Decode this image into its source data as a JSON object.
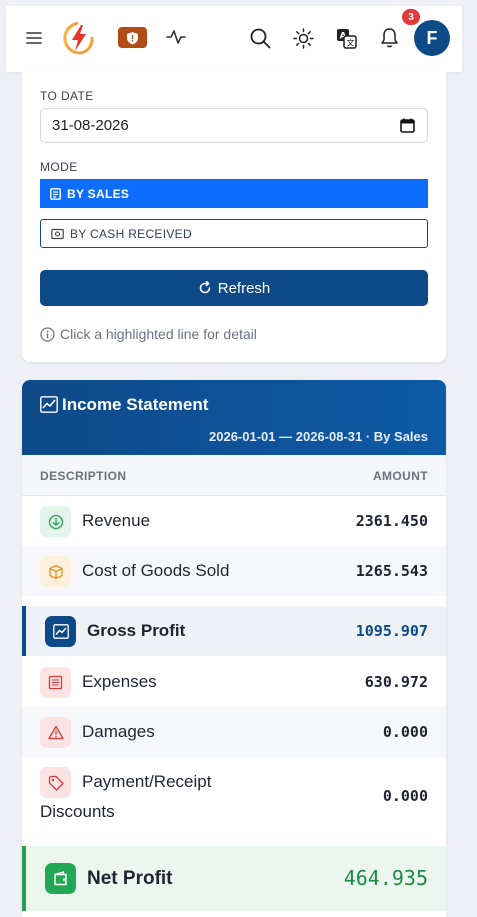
{
  "topbar": {
    "icons": [
      "hamburger-menu-icon",
      "app-logo",
      "shield-icon",
      "activity-pulse-icon",
      "search-icon",
      "theme-sun-icon",
      "translate-icon",
      "bell-icon"
    ],
    "notification_count": "3",
    "avatar_initial": "F"
  },
  "filters": {
    "to_date_label": "TO DATE",
    "to_date_value": "31-08-2026",
    "mode_label": "MODE",
    "mode_by_sales": "BY SALES",
    "mode_by_cash": "BY CASH RECEIVED",
    "refresh_label": "Refresh",
    "hint": "Click a highlighted line for detail"
  },
  "income": {
    "title": "Income Statement",
    "range": "2026-01-01 — 2026-08-31 · By Sales",
    "col_description": "DESCRIPTION",
    "col_amount": "AMOUNT",
    "rows": [
      {
        "label": "Revenue",
        "amount": "2361.450",
        "icon": "arrow-down-circle-icon"
      },
      {
        "label": "Cost of Goods Sold",
        "amount": "1265.543",
        "icon": "box-icon"
      },
      {
        "label": "Gross Profit",
        "amount": "1095.907",
        "icon": "trend-chart-icon"
      },
      {
        "label": "Expenses",
        "amount": "630.972",
        "icon": "receipt-icon"
      },
      {
        "label": "Damages",
        "amount": "0.000",
        "icon": "warning-icon"
      },
      {
        "label": "Payment/Receipt Discounts",
        "amount": "0.000",
        "icon": "tag-icon"
      }
    ],
    "net_label": "Net Profit",
    "net_amount": "464.935"
  },
  "colors": {
    "primary": "#0f4a88",
    "active_blue": "#0d6efd",
    "net_green": "#1f8a45",
    "badge_red": "#e03a3a"
  }
}
